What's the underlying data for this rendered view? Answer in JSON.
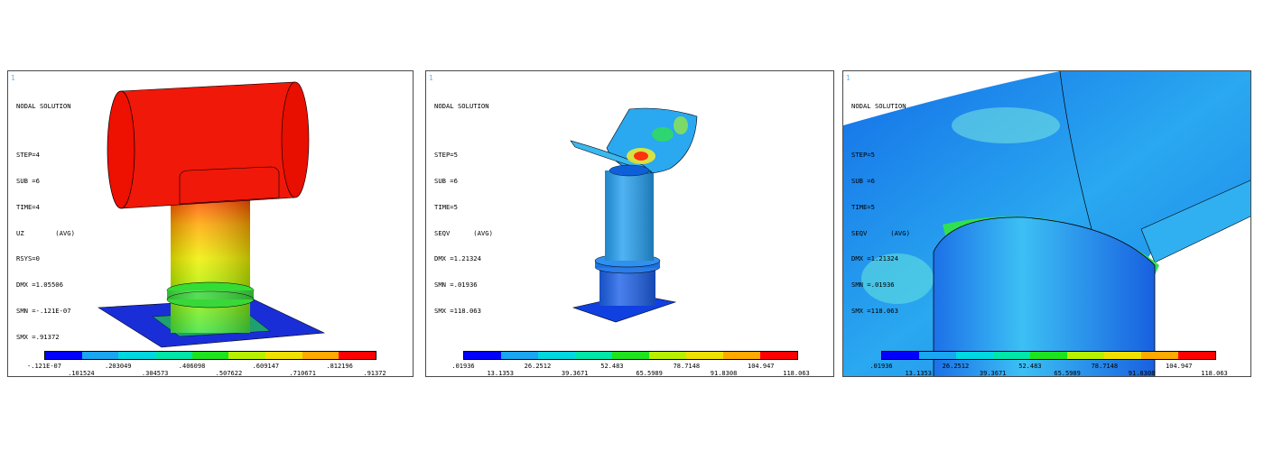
{
  "legend_colors": [
    "#0000ff",
    "#1aa6f0",
    "#00d8e0",
    "#00e6a8",
    "#1ee31e",
    "#b8f000",
    "#f0e000",
    "#ffa800",
    "#ff0000"
  ],
  "panels": [
    {
      "window_number": "1",
      "title": "NODAL SOLUTION",
      "lines": [
        "STEP=4",
        "SUB =6",
        "TIME=4",
        "UZ        (AVG)",
        "RSYS=0",
        "DMX =1.05506",
        "SMN =-.121E-07",
        "SMX =.91372"
      ],
      "legend_top": [
        "-.121E-07",
        ".203049",
        ".406098",
        ".609147",
        ".812196"
      ],
      "legend_bottom": [
        ".101524",
        ".304573",
        ".507622",
        ".710671",
        ".91372"
      ]
    },
    {
      "window_number": "1",
      "title": "NODAL SOLUTION",
      "lines": [
        "STEP=5",
        "SUB =6",
        "TIME=5",
        "SEQV      (AVG)",
        "DMX =1.21324",
        "SMN =.01936",
        "SMX =118.063"
      ],
      "legend_top": [
        ".01936",
        "26.2512",
        "52.483",
        "78.7148",
        "104.947"
      ],
      "legend_bottom": [
        "13.1353",
        "39.3671",
        "65.5989",
        "91.8308",
        "118.063"
      ]
    },
    {
      "window_number": "1",
      "title": "NODAL SOLUTION",
      "lines": [
        "STEP=5",
        "SUB =6",
        "TIME=5",
        "SEQV      (AVG)",
        "DMX =1.21324",
        "SMN =.01936",
        "SMX =118.063"
      ],
      "legend_top": [
        ".01936",
        "26.2512",
        "52.483",
        "78.7148",
        "104.947"
      ],
      "legend_bottom": [
        "13.1353",
        "39.3671",
        "65.5989",
        "91.8308",
        "118.063"
      ]
    }
  ]
}
